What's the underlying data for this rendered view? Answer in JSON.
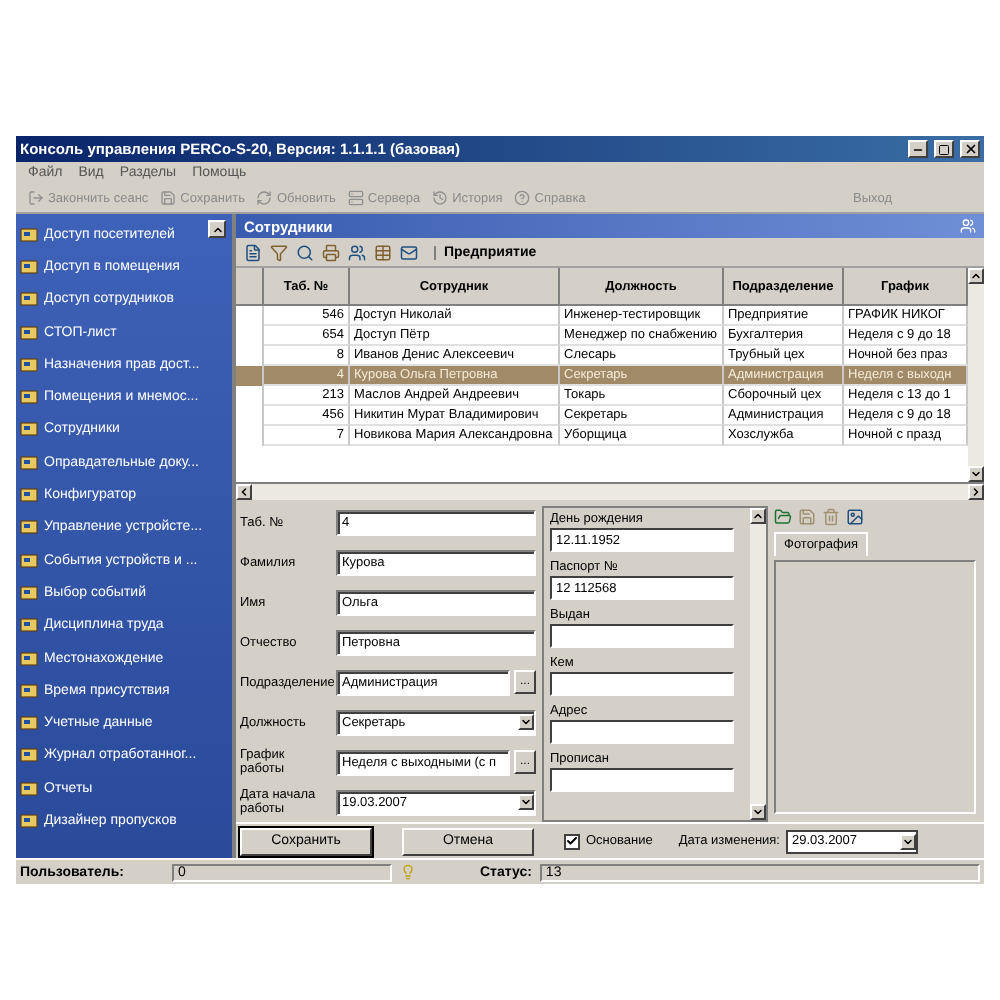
{
  "window": {
    "title": "Консоль управления PERCo-S-20, Версия: 1.1.1.1 (базовая)"
  },
  "menu": [
    "Файл",
    "Вид",
    "Разделы",
    "Помощь"
  ],
  "toolbar": [
    {
      "label": "Закончить сеанс",
      "kind": "logout",
      "disabled": true
    },
    {
      "label": "Сохранить",
      "kind": "save",
      "disabled": true
    },
    {
      "label": "Обновить",
      "kind": "refresh",
      "disabled": true
    },
    {
      "label": "Сервера",
      "kind": "server",
      "disabled": true
    },
    {
      "label": "История",
      "kind": "history",
      "disabled": true
    },
    {
      "label": "Справка",
      "kind": "help",
      "disabled": true
    }
  ],
  "exit": {
    "label": "Выход",
    "disabled": true
  },
  "sidebar": {
    "items": [
      {
        "label": "Доступ посетителей",
        "selected": false
      },
      {
        "label": "Доступ в помещения",
        "selected": false
      },
      {
        "label": "Доступ сотрудников",
        "selected": false
      },
      {
        "label": "СТОП-лист",
        "selected": false
      },
      {
        "label": "Назначения прав дост...",
        "selected": false
      },
      {
        "label": "Помещения и мнемос...",
        "selected": false
      },
      {
        "label": "Сотрудники",
        "selected": false
      },
      {
        "label": "Оправдательные доку...",
        "selected": false
      },
      {
        "label": "Конфигуратор",
        "selected": false
      },
      {
        "label": "Управление устройсте...",
        "selected": false
      },
      {
        "label": "События устройств и ...",
        "selected": false
      },
      {
        "label": "Выбор событий",
        "selected": false
      },
      {
        "label": "Дисциплина труда",
        "selected": false
      },
      {
        "label": "Местонахождение",
        "selected": false
      },
      {
        "label": "Время присутствия",
        "selected": false
      },
      {
        "label": "Учетные данные",
        "selected": false
      },
      {
        "label": "Журнал отработанног...",
        "selected": false
      },
      {
        "label": "Отчеты",
        "selected": false
      },
      {
        "label": "Дизайнер пропусков",
        "selected": false
      }
    ]
  },
  "panel": {
    "title": "Сотрудники",
    "filter": "Предприятие"
  },
  "table": {
    "columns": [
      "Таб. №",
      "Сотрудник",
      "Должность",
      "Подразделение",
      "График"
    ],
    "rows": [
      {
        "cells": [
          "546",
          "Доступ Николай",
          "Инженер-тестировщик",
          "Предприятие",
          "ГРАФИК НИКОГ"
        ],
        "selected": false
      },
      {
        "cells": [
          "654",
          "Доступ Пётр",
          "Менеджер по снабжению",
          "Бухгалтерия",
          "Неделя с 9 до 18"
        ],
        "selected": false
      },
      {
        "cells": [
          "8",
          "Иванов Денис Алексеевич",
          "Слесарь",
          "Трубный цех",
          "Ночной без праз"
        ],
        "selected": false
      },
      {
        "cells": [
          "4",
          "Курова Ольга Петровна",
          "Секретарь",
          "Администрация",
          "Неделя с выходн"
        ],
        "selected": true
      },
      {
        "cells": [
          "213",
          "Маслов Андрей Андреевич",
          "Токарь",
          "Сборочный цех",
          "Неделя с 13 до 1"
        ],
        "selected": false
      },
      {
        "cells": [
          "456",
          "Никитин Мурат Владимирович",
          "Секретарь",
          "Администрация",
          "Неделя с 9 до 18"
        ],
        "selected": false
      },
      {
        "cells": [
          "7",
          "Новикова Мария Александровна",
          "Уборщица",
          "Хозслужба",
          "Ночной с празд"
        ],
        "selected": false
      }
    ]
  },
  "form": {
    "fields": [
      {
        "label": "Таб. №",
        "value": "4",
        "kind": "text"
      },
      {
        "label": "Фамилия",
        "value": "Курова",
        "kind": "text"
      },
      {
        "label": "Имя",
        "value": "Ольга",
        "kind": "text"
      },
      {
        "label": "Отчество",
        "value": "Петровна",
        "kind": "text"
      },
      {
        "label": "Подразделение",
        "value": "Администрация",
        "kind": "browse",
        "button": "..."
      },
      {
        "label": "Должность",
        "value": "Секретарь",
        "kind": "select"
      },
      {
        "label": "График работы",
        "value": "Неделя с выходными (с п",
        "kind": "browse",
        "button": "..."
      },
      {
        "label": "Дата начала работы",
        "value": "19.03.2007",
        "kind": "select"
      }
    ]
  },
  "details": {
    "fields": [
      {
        "label": "День рождения",
        "value": "12.11.1952"
      },
      {
        "label": "Паспорт №",
        "value": "12 112568"
      },
      {
        "label": "Выдан"
      },
      {
        "label": "Кем"
      },
      {
        "label": "Адрес"
      },
      {
        "label": "Прописан"
      }
    ]
  },
  "photo": {
    "tab": "Фотография"
  },
  "buttons": [
    "Сохранить",
    "Отмена"
  ],
  "basis": {
    "label": "Основание",
    "checked": true
  },
  "changed": {
    "label": "Дата изменения:",
    "value": "29.03.2007"
  },
  "status_bar": {
    "user_label": "Пользователь:",
    "user": "0",
    "status_label": "Статус:",
    "status": "13"
  }
}
